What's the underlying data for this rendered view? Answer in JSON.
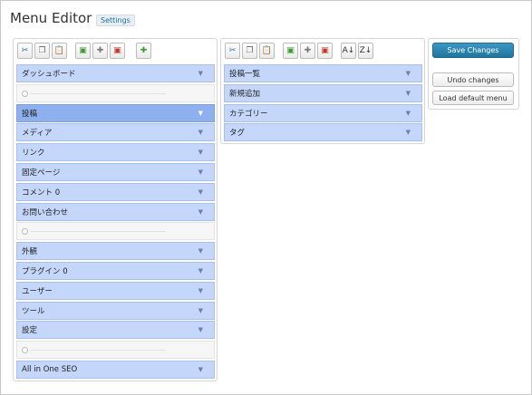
{
  "header": {
    "title": "Menu Editor",
    "settings_label": "Settings"
  },
  "toolbar_left": [
    {
      "icon": "scissors-icon",
      "glyph": "✂",
      "color": "#2a6fb0"
    },
    {
      "icon": "copy-icon",
      "glyph": "❐",
      "color": "#666"
    },
    {
      "icon": "paste-icon",
      "glyph": "📋",
      "color": "#a07020"
    },
    {
      "icon": "new-menu-icon",
      "glyph": "▣",
      "color": "#3b9a2f"
    },
    {
      "icon": "new-separator-icon",
      "glyph": "✚",
      "color": "#777"
    },
    {
      "icon": "delete-icon",
      "glyph": "▣",
      "color": "#c0392b"
    },
    {
      "icon": "add-icon",
      "glyph": "✚",
      "color": "#3b9a2f"
    }
  ],
  "toolbar_mid": [
    {
      "icon": "scissors-icon",
      "glyph": "✂",
      "color": "#2a6fb0"
    },
    {
      "icon": "copy-icon",
      "glyph": "❐",
      "color": "#666"
    },
    {
      "icon": "paste-icon",
      "glyph": "📋",
      "color": "#a07020"
    },
    {
      "icon": "new-item-icon",
      "glyph": "▣",
      "color": "#3b9a2f"
    },
    {
      "icon": "new-separator-icon",
      "glyph": "✚",
      "color": "#777"
    },
    {
      "icon": "delete-icon",
      "glyph": "▣",
      "color": "#c0392b"
    },
    {
      "icon": "sort-ascending-icon",
      "glyph": "A↓",
      "color": "#333"
    },
    {
      "icon": "sort-descending-icon",
      "glyph": "Z↓",
      "color": "#333"
    }
  ],
  "menu_left": [
    {
      "type": "item",
      "label": "ダッシュボード"
    },
    {
      "type": "separator"
    },
    {
      "type": "item",
      "label": "投稿",
      "active": true
    },
    {
      "type": "item",
      "label": "メディア"
    },
    {
      "type": "item",
      "label": "リンク"
    },
    {
      "type": "item",
      "label": "固定ページ"
    },
    {
      "type": "item",
      "label": "コメント 0"
    },
    {
      "type": "item",
      "label": "お問い合わせ"
    },
    {
      "type": "separator"
    },
    {
      "type": "item",
      "label": "外観"
    },
    {
      "type": "item",
      "label": "プラグイン 0"
    },
    {
      "type": "item",
      "label": "ユーザー"
    },
    {
      "type": "item",
      "label": "ツール"
    },
    {
      "type": "item",
      "label": "設定"
    },
    {
      "type": "separator"
    },
    {
      "type": "item",
      "label": "All in One SEO"
    }
  ],
  "menu_mid": [
    {
      "label": "投稿一覧"
    },
    {
      "label": "新規追加"
    },
    {
      "label": "カテゴリー"
    },
    {
      "label": "タグ"
    }
  ],
  "actions": {
    "save_label": "Save Changes",
    "undo_label": "Undo changes",
    "default_label": "Load default menu"
  }
}
